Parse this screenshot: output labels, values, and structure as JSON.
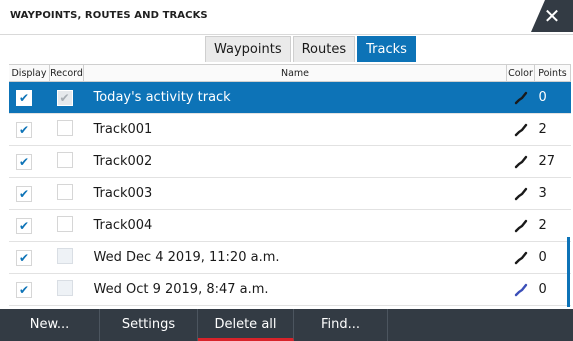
{
  "window": {
    "title": "WAYPOINTS, ROUTES AND TRACKS",
    "close_glyph": "✕"
  },
  "tabs": [
    {
      "label": "Waypoints",
      "active": false
    },
    {
      "label": "Routes",
      "active": false
    },
    {
      "label": "Tracks",
      "active": true
    }
  ],
  "table": {
    "headers": {
      "display": "Display",
      "record": "Record",
      "name": "Name",
      "color": "Color",
      "points": "Points"
    },
    "rows": [
      {
        "display": true,
        "record": true,
        "name": "Today's activity track",
        "color": "#1a1a1a",
        "points": "0",
        "selected": true
      },
      {
        "display": true,
        "record": false,
        "name": "Track001",
        "color": "#1a1a1a",
        "points": "2",
        "selected": false
      },
      {
        "display": true,
        "record": false,
        "name": "Track002",
        "color": "#1a1a1a",
        "points": "27",
        "selected": false
      },
      {
        "display": true,
        "record": false,
        "name": "Track003",
        "color": "#1a1a1a",
        "points": "3",
        "selected": false
      },
      {
        "display": true,
        "record": false,
        "name": "Track004",
        "color": "#1a1a1a",
        "points": "2",
        "selected": false
      },
      {
        "display": true,
        "record": false,
        "record_dim": true,
        "name": "Wed Dec 4 2019, 11:20 a.m.",
        "color": "#1a1a1a",
        "points": "0",
        "selected": false
      },
      {
        "display": true,
        "record": false,
        "record_dim": true,
        "name": "Wed Oct 9 2019, 8:47 a.m.",
        "color": "#3b4fb8",
        "points": "0",
        "selected": false
      }
    ]
  },
  "bottom_bar": {
    "new_label": "New...",
    "settings_label": "Settings",
    "delete_all_label": "Delete all",
    "find_label": "Find..."
  },
  "colors": {
    "accent": "#0d73b7",
    "bar": "#333b44",
    "active_underline": "#d8232a"
  },
  "icons": {
    "check": "check-icon",
    "color": "track-color-icon",
    "close": "close-icon"
  }
}
